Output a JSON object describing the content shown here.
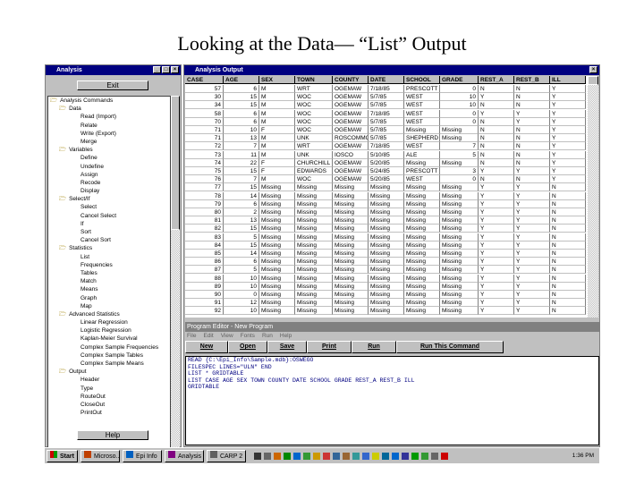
{
  "slide_title": "Looking at the Data— “List” Output",
  "left_window": {
    "title": "Analysis",
    "exit_label": "Exit",
    "help_label": "Help",
    "tree": [
      {
        "label": "Analysis Commands",
        "level": 0,
        "folder": true
      },
      {
        "label": "Data",
        "level": 1,
        "folder": true
      },
      {
        "label": "Read (Import)",
        "level": 2
      },
      {
        "label": "Relate",
        "level": 2
      },
      {
        "label": "Write (Export)",
        "level": 2
      },
      {
        "label": "Merge",
        "level": 2
      },
      {
        "label": "Variables",
        "level": 1,
        "folder": true
      },
      {
        "label": "Define",
        "level": 2
      },
      {
        "label": "Undefine",
        "level": 2
      },
      {
        "label": "Assign",
        "level": 2
      },
      {
        "label": "Recode",
        "level": 2
      },
      {
        "label": "Display",
        "level": 2
      },
      {
        "label": "Select/If",
        "level": 1,
        "folder": true
      },
      {
        "label": "Select",
        "level": 2
      },
      {
        "label": "Cancel Select",
        "level": 2
      },
      {
        "label": "If",
        "level": 2
      },
      {
        "label": "Sort",
        "level": 2
      },
      {
        "label": "Cancel Sort",
        "level": 2
      },
      {
        "label": "Statistics",
        "level": 1,
        "folder": true
      },
      {
        "label": "List",
        "level": 2
      },
      {
        "label": "Frequencies",
        "level": 2
      },
      {
        "label": "Tables",
        "level": 2
      },
      {
        "label": "Match",
        "level": 2
      },
      {
        "label": "Means",
        "level": 2
      },
      {
        "label": "Graph",
        "level": 2
      },
      {
        "label": "Map",
        "level": 2
      },
      {
        "label": "Advanced Statistics",
        "level": 1,
        "folder": true
      },
      {
        "label": "Linear Regression",
        "level": 2
      },
      {
        "label": "Logistic Regression",
        "level": 2
      },
      {
        "label": "Kaplan-Meier Survival",
        "level": 2
      },
      {
        "label": "Complex Sample Frequencies",
        "level": 2
      },
      {
        "label": "Complex Sample Tables",
        "level": 2
      },
      {
        "label": "Complex Sample Means",
        "level": 2
      },
      {
        "label": "Output",
        "level": 1,
        "folder": true
      },
      {
        "label": "Header",
        "level": 2
      },
      {
        "label": "Type",
        "level": 2
      },
      {
        "label": "RouteOut",
        "level": 2
      },
      {
        "label": "CloseOut",
        "level": 2
      },
      {
        "label": "PrintOut",
        "level": 2
      }
    ]
  },
  "output_window": {
    "title": "Analysis Output",
    "columns": [
      "CASE",
      "AGE",
      "SEX",
      "TOWN",
      "COUNTY",
      "DATE",
      "SCHOOL",
      "GRADE",
      "REST_A",
      "REST_B",
      "ILL"
    ],
    "rows": [
      [
        "57",
        "6",
        "M",
        "WRT",
        "OGEMAW",
        "7/18/85",
        "PRESCOTT",
        "0",
        "N",
        "N",
        "Y"
      ],
      [
        "30",
        "15",
        "M",
        "WOC",
        "OGEMAW",
        "5/7/85",
        "WEST",
        "10",
        "Y",
        "N",
        "Y"
      ],
      [
        "34",
        "15",
        "M",
        "WOC",
        "OGEMAW",
        "5/7/85",
        "WEST",
        "10",
        "N",
        "N",
        "Y"
      ],
      [
        "58",
        "6",
        "M",
        "WOC",
        "OGEMAW",
        "7/18/85",
        "WEST",
        "0",
        "Y",
        "Y",
        "Y"
      ],
      [
        "70",
        "6",
        "M",
        "WOC",
        "OGEMAW",
        "5/7/85",
        "WEST",
        "0",
        "N",
        "Y",
        "Y"
      ],
      [
        "71",
        "10",
        "F",
        "WOC",
        "OGEMAW",
        "5/7/85",
        "Missing",
        "Missing",
        "N",
        "N",
        "Y"
      ],
      [
        "71",
        "13",
        "M",
        "UNK",
        "ROSCOMMON",
        "5/7/85",
        "SHEPHERD",
        "Missing",
        "N",
        "N",
        "Y"
      ],
      [
        "72",
        "7",
        "M",
        "WRT",
        "OGEMAW",
        "7/18/85",
        "WEST",
        "7",
        "N",
        "N",
        "Y"
      ],
      [
        "73",
        "11",
        "M",
        "UNK",
        "IOSCO",
        "5/10/85",
        "ALE",
        "5",
        "N",
        "N",
        "Y"
      ],
      [
        "74",
        "22",
        "F",
        "CHURCHILL",
        "OGEMAW",
        "5/20/85",
        "Missing",
        "Missing",
        "N",
        "N",
        "Y"
      ],
      [
        "75",
        "15",
        "F",
        "EDWARDS",
        "OGEMAW",
        "5/24/85",
        "PRESCOTT",
        "3",
        "Y",
        "Y",
        "Y"
      ],
      [
        "76",
        "7",
        "M",
        "WOC",
        "OGEMAW",
        "5/20/85",
        "WEST",
        "0",
        "N",
        "N",
        "Y"
      ],
      [
        "77",
        "15",
        "Missing",
        "Missing",
        "Missing",
        "Missing",
        "Missing",
        "Missing",
        "Y",
        "Y",
        "N"
      ],
      [
        "78",
        "14",
        "Missing",
        "Missing",
        "Missing",
        "Missing",
        "Missing",
        "Missing",
        "Y",
        "Y",
        "N"
      ],
      [
        "79",
        "6",
        "Missing",
        "Missing",
        "Missing",
        "Missing",
        "Missing",
        "Missing",
        "Y",
        "Y",
        "N"
      ],
      [
        "80",
        "2",
        "Missing",
        "Missing",
        "Missing",
        "Missing",
        "Missing",
        "Missing",
        "Y",
        "Y",
        "N"
      ],
      [
        "81",
        "13",
        "Missing",
        "Missing",
        "Missing",
        "Missing",
        "Missing",
        "Missing",
        "Y",
        "Y",
        "N"
      ],
      [
        "82",
        "15",
        "Missing",
        "Missing",
        "Missing",
        "Missing",
        "Missing",
        "Missing",
        "Y",
        "Y",
        "N"
      ],
      [
        "83",
        "5",
        "Missing",
        "Missing",
        "Missing",
        "Missing",
        "Missing",
        "Missing",
        "Y",
        "Y",
        "N"
      ],
      [
        "84",
        "15",
        "Missing",
        "Missing",
        "Missing",
        "Missing",
        "Missing",
        "Missing",
        "Y",
        "Y",
        "N"
      ],
      [
        "85",
        "14",
        "Missing",
        "Missing",
        "Missing",
        "Missing",
        "Missing",
        "Missing",
        "Y",
        "Y",
        "N"
      ],
      [
        "86",
        "6",
        "Missing",
        "Missing",
        "Missing",
        "Missing",
        "Missing",
        "Missing",
        "Y",
        "Y",
        "N"
      ],
      [
        "87",
        "5",
        "Missing",
        "Missing",
        "Missing",
        "Missing",
        "Missing",
        "Missing",
        "Y",
        "Y",
        "N"
      ],
      [
        "88",
        "10",
        "Missing",
        "Missing",
        "Missing",
        "Missing",
        "Missing",
        "Missing",
        "Y",
        "Y",
        "N"
      ],
      [
        "89",
        "10",
        "Missing",
        "Missing",
        "Missing",
        "Missing",
        "Missing",
        "Missing",
        "Y",
        "Y",
        "N"
      ],
      [
        "90",
        "0",
        "Missing",
        "Missing",
        "Missing",
        "Missing",
        "Missing",
        "Missing",
        "Y",
        "Y",
        "N"
      ],
      [
        "91",
        "12",
        "Missing",
        "Missing",
        "Missing",
        "Missing",
        "Missing",
        "Missing",
        "Y",
        "Y",
        "N"
      ],
      [
        "92",
        "10",
        "Missing",
        "Missing",
        "Missing",
        "Missing",
        "Missing",
        "Missing",
        "Y",
        "Y",
        "N"
      ]
    ]
  },
  "program_editor": {
    "title": "Program Editor - New Program",
    "menu": [
      "File",
      "Edit",
      "View",
      "Fonts",
      "Run",
      "Help"
    ],
    "buttons": [
      "New",
      "Open",
      "Save",
      "Print",
      "Run",
      "Run This Command"
    ],
    "code": [
      "READ {C:\\Epi_Info\\Sample.mdb}:OSWEGO",
      "FILESPEC LINES=\"ULN\" END",
      "LIST * GRIDTABLE",
      "LIST CASE AGE SEX TOWN COUNTY DATE SCHOOL GRADE REST_A REST_B ILL",
      "GRIDTABLE"
    ]
  },
  "taskbar": {
    "start": "Start",
    "tasks": [
      "Microso...",
      "Epi Info",
      "Analysis",
      "CARP 2"
    ],
    "clock": "1:36 PM"
  }
}
